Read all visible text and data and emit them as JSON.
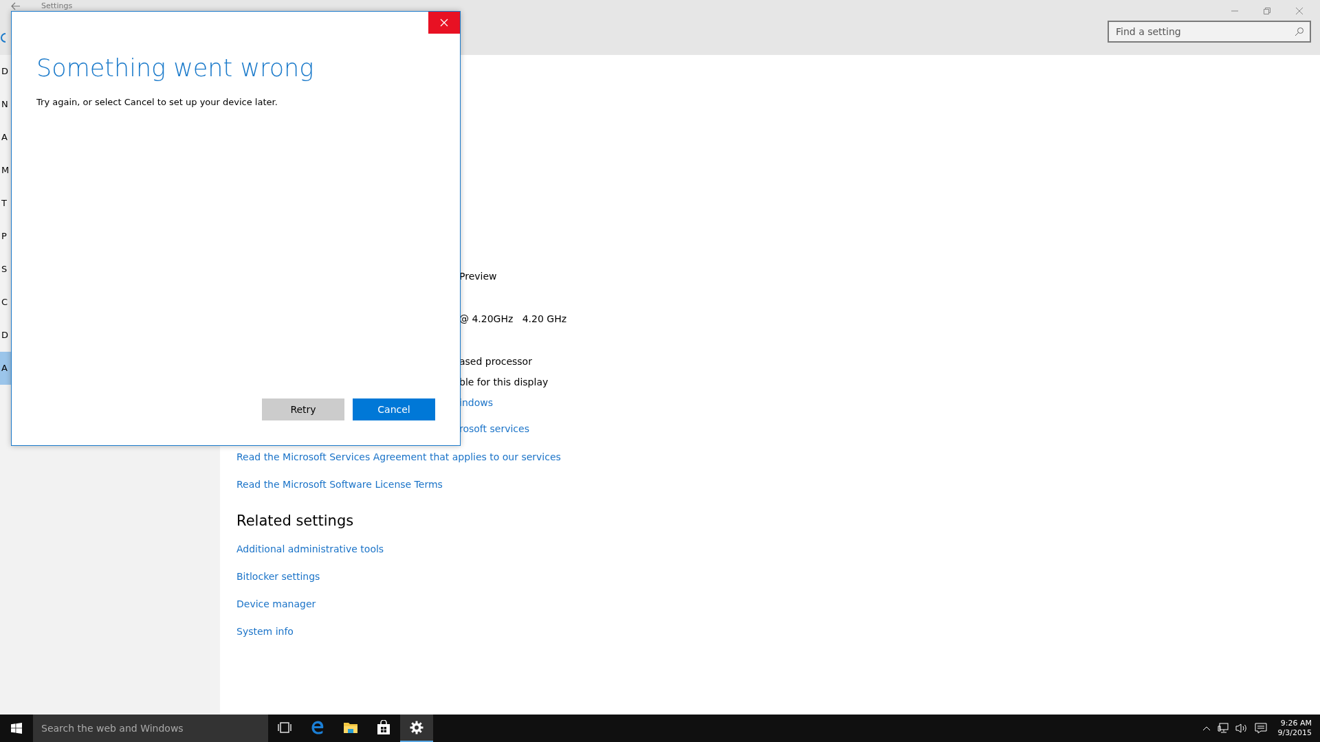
{
  "window": {
    "title": "Settings"
  },
  "search": {
    "placeholder": "Find a setting"
  },
  "sidebar": {
    "items": [
      {
        "label": "D",
        "selected": false
      },
      {
        "label": "N",
        "selected": false
      },
      {
        "label": "A",
        "selected": false
      },
      {
        "label": "M",
        "selected": false
      },
      {
        "label": "T",
        "selected": false
      },
      {
        "label": "P",
        "selected": false
      },
      {
        "label": "S",
        "selected": false
      },
      {
        "label": "C",
        "selected": false
      },
      {
        "label": "D",
        "selected": false
      },
      {
        "label": "A",
        "selected": true
      }
    ]
  },
  "content": {
    "fragments": [
      {
        "text": "Preview",
        "kind": "text"
      },
      {
        "text": "@ 4.20GHz   4.20 GHz",
        "kind": "text"
      },
      {
        "text": "ased processor",
        "kind": "text"
      },
      {
        "text": "ble for this display",
        "kind": "text"
      },
      {
        "text": "indows",
        "kind": "link"
      },
      {
        "text": "rosoft services",
        "kind": "link"
      }
    ],
    "links": [
      "Read the Microsoft Services Agreement that applies to our services",
      "Read the Microsoft Software License Terms"
    ],
    "related": {
      "heading": "Related settings",
      "links": [
        "Additional administrative tools",
        "Bitlocker settings",
        "Device manager",
        "System info"
      ]
    }
  },
  "dialog": {
    "title": "Something went wrong",
    "message": "Try again, or select Cancel to set up your device later.",
    "buttons": [
      {
        "label": "Retry",
        "kind": "secondary"
      },
      {
        "label": "Cancel",
        "kind": "primary"
      }
    ]
  },
  "taskbar": {
    "search_placeholder": "Search the web and Windows",
    "apps": [
      {
        "kind": "task-view",
        "active": false
      },
      {
        "kind": "browser",
        "active": false
      },
      {
        "kind": "folder",
        "active": false
      },
      {
        "kind": "store",
        "active": false
      },
      {
        "kind": "settings",
        "active": true
      }
    ],
    "clock": {
      "time": "9:26 AM",
      "date": "9/3/2015"
    }
  }
}
